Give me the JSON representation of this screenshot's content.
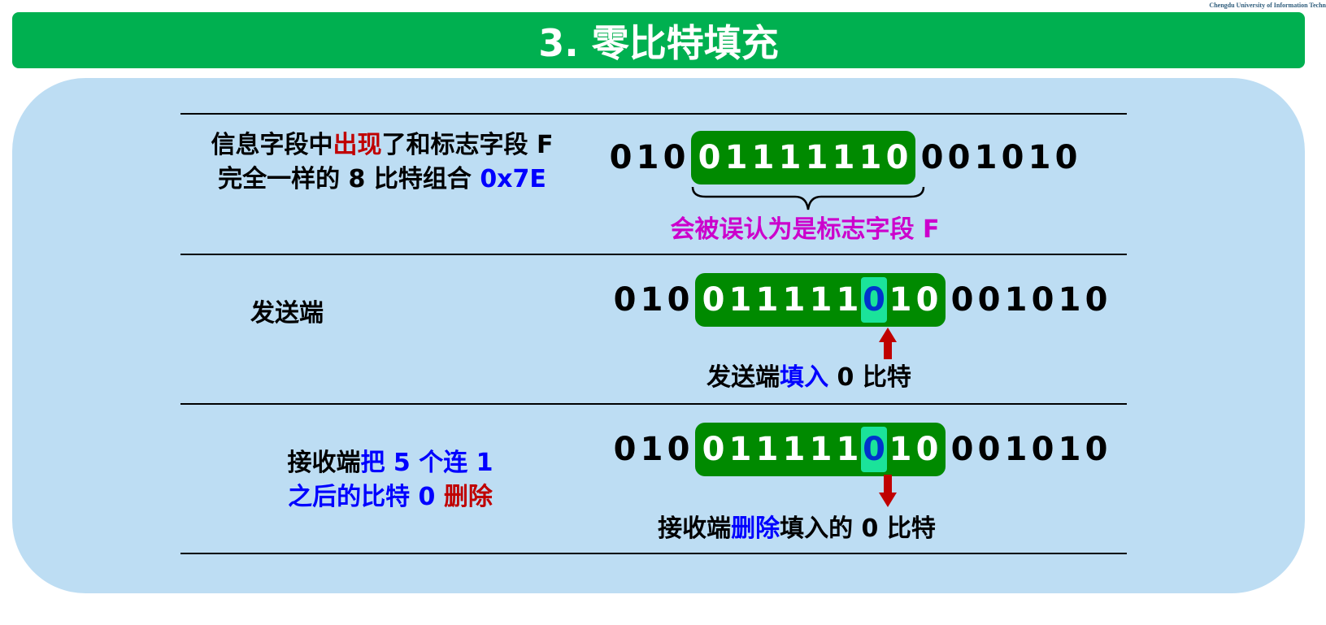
{
  "watermark": "Chengdu University of Information Techn",
  "title": "3. 零比特填充",
  "row1": {
    "desc_a": "信息字段中",
    "desc_b": "出现",
    "desc_c": "了和标志字段 F",
    "desc_d": "完全一样的 8 比特组合 ",
    "desc_e": "0x7E",
    "bits_before": [
      "0",
      "1",
      "0"
    ],
    "bits_flag": [
      "0",
      "1",
      "1",
      "1",
      "1",
      "1",
      "1",
      "0"
    ],
    "bits_after": [
      "0",
      "0",
      "1",
      "0",
      "1",
      "0"
    ],
    "note": "会被误认为是标志字段 F"
  },
  "row2": {
    "label": "发送端",
    "bits_before": [
      "0",
      "1",
      "0"
    ],
    "bits_group_a": [
      "0",
      "1",
      "1",
      "1",
      "1",
      "1"
    ],
    "bit_stuffed": "0",
    "bits_group_b": [
      "1",
      "0"
    ],
    "bits_after": [
      "0",
      "0",
      "1",
      "0",
      "1",
      "0"
    ],
    "note_a": "发送端",
    "note_b": "填入",
    "note_c": " 0 比特"
  },
  "row3": {
    "label_a": "接收端",
    "label_b": "把 5 个连 1",
    "label_c": "之后的比特 0 ",
    "label_d": "删除",
    "bits_before": [
      "0",
      "1",
      "0"
    ],
    "bits_group_a": [
      "0",
      "1",
      "1",
      "1",
      "1",
      "1"
    ],
    "bit_stuffed": "0",
    "bits_group_b": [
      "1",
      "0"
    ],
    "bits_after": [
      "0",
      "0",
      "1",
      "0",
      "1",
      "0"
    ],
    "note_a": "接收端",
    "note_b": "删除",
    "note_c": "填入的 0 比特"
  },
  "colors": {
    "title_bg": "#00b050",
    "panel_bg": "#bdddf3",
    "bit_group_bg": "#008a00",
    "stuffed_bit_bg": "#1be39a",
    "emphasis_red": "#c00000",
    "emphasis_blue": "#0000ff",
    "emphasis_magenta": "#cc00cc"
  }
}
